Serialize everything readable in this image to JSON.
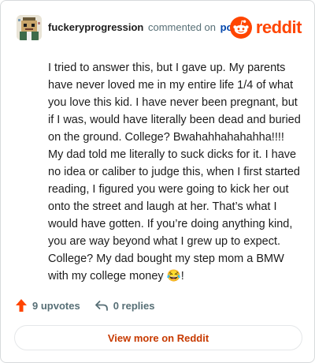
{
  "header": {
    "username": "fuckeryprogression",
    "commented_text": "commented on",
    "post_link": "post",
    "brand_name": "reddit"
  },
  "comment": {
    "body": "I tried to answer this, but I gave up. My parents have never loved me in my entire life 1/4 of what you love this kid. I have never been pregnant, but if I was, would have literally been dead and buried on the ground. College? Bwahahhahahahha!!!! My dad told me literally to suck dicks for it. I have no idea or caliber to judge this, when I first started reading, I figured you were going to kick her out onto the street and laugh at her. That’s what I would have gotten. If you’re doing anything kind, you are way beyond what I grew up to expect. College? My dad bought my step mom a BMW with my college money 😂!"
  },
  "actions": {
    "upvotes": "9 upvotes",
    "replies": "0 replies"
  },
  "footer": {
    "view_more": "View more on Reddit"
  },
  "colors": {
    "brand": "#ff4500",
    "link": "#0045ac",
    "muted": "#576f76",
    "view_more_text": "#c73a00"
  },
  "icons": {
    "avatar": "pixel-art-avatar",
    "brand_logo": "reddit-snoo-icon",
    "upvote": "upvote-arrow-icon",
    "reply": "reply-arrow-icon"
  }
}
